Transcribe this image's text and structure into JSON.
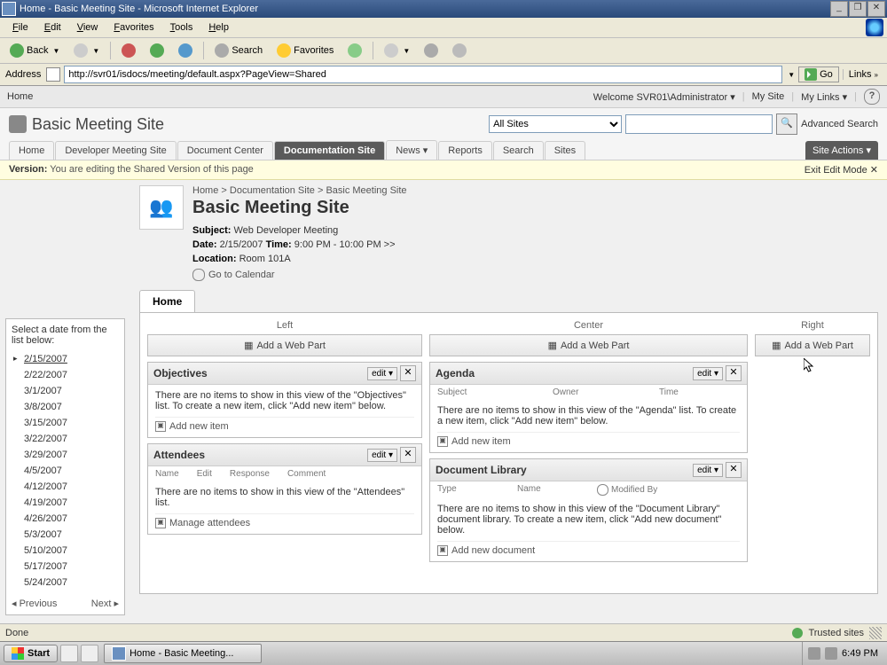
{
  "window": {
    "title": "Home - Basic Meeting Site - Microsoft Internet Explorer"
  },
  "menu": {
    "file": "File",
    "edit": "Edit",
    "view": "View",
    "favorites": "Favorites",
    "tools": "Tools",
    "help": "Help"
  },
  "toolbar": {
    "back": "Back",
    "search": "Search",
    "favorites": "Favorites"
  },
  "address": {
    "label": "Address",
    "url": "http://svr01/isdocs/meeting/default.aspx?PageView=Shared",
    "go": "Go",
    "links": "Links"
  },
  "sp": {
    "home": "Home",
    "welcome": "Welcome SVR01\\Administrator ▾",
    "mysite": "My Site",
    "mylinks": "My Links ▾",
    "site_title": "Basic Meeting Site",
    "scope": "All Sites",
    "advanced": "Advanced Search",
    "tabs": [
      "Home",
      "Developer Meeting Site",
      "Document Center",
      "Documentation Site",
      "News ▾",
      "Reports",
      "Search",
      "Sites"
    ],
    "active_tab": 3,
    "site_actions": "Site Actions ▾",
    "version_label": "Version:",
    "version_text": "You are editing the Shared Version of this page",
    "exit": "Exit Edit Mode ✕"
  },
  "breadcrumb": {
    "a": "Home",
    "b": "Documentation Site",
    "c": "Basic Meeting Site"
  },
  "meeting": {
    "title": "Basic Meeting Site",
    "subject_label": "Subject:",
    "subject": "Web Developer Meeting",
    "date_label": "Date:",
    "date": "2/15/2007",
    "time_label": "Time:",
    "time": "9:00 PM - 10:00 PM",
    "more": ">>",
    "location_label": "Location:",
    "location": "Room 101A",
    "gotocal": "Go to Calendar",
    "home_tab": "Home"
  },
  "zones": {
    "left": "Left",
    "center": "Center",
    "right": "Right",
    "add": "Add a Web Part",
    "edit": "edit ▾",
    "close": "✕"
  },
  "wp_objectives": {
    "title": "Objectives",
    "empty": "There are no items to show in this view of the \"Objectives\" list. To create a new item, click \"Add new item\" below.",
    "action": "Add new item"
  },
  "wp_attendees": {
    "title": "Attendees",
    "cols": {
      "a": "Name",
      "b": "Edit",
      "c": "Response",
      "d": "Comment"
    },
    "empty": "There are no items to show in this view of the \"Attendees\" list.",
    "action": "Manage attendees"
  },
  "wp_agenda": {
    "title": "Agenda",
    "cols": {
      "a": "Subject",
      "b": "Owner",
      "c": "Time"
    },
    "empty": "There are no items to show in this view of the \"Agenda\" list. To create a new item, click \"Add new item\" below.",
    "action": "Add new item"
  },
  "wp_doclib": {
    "title": "Document Library",
    "cols": {
      "a": "Type",
      "b": "Name",
      "c": "Modified By"
    },
    "empty": "There are no items to show in this view of the \"Document Library\" document library. To create a new item, click \"Add new document\" below.",
    "action": "Add new document"
  },
  "datepanel": {
    "head": "Select a date from the list below:",
    "dates": [
      "2/15/2007",
      "2/22/2007",
      "3/1/2007",
      "3/8/2007",
      "3/15/2007",
      "3/22/2007",
      "3/29/2007",
      "4/5/2007",
      "4/12/2007",
      "4/19/2007",
      "4/26/2007",
      "5/3/2007",
      "5/10/2007",
      "5/17/2007",
      "5/24/2007"
    ],
    "prev": "◂ Previous",
    "next": "Next ▸"
  },
  "status": {
    "done": "Done",
    "trusted": "Trusted sites"
  },
  "taskbar": {
    "start": "Start",
    "task": "Home - Basic Meeting...",
    "time": "6:49 PM"
  }
}
